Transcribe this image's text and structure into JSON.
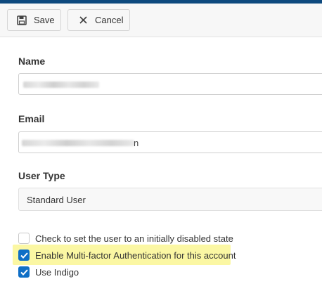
{
  "toolbar": {
    "save_label": "Save",
    "cancel_label": "Cancel"
  },
  "form": {
    "name_label": "Name",
    "email_label": "Email",
    "email_visible_tail": "n",
    "user_type_label": "User Type",
    "user_type_value": "Standard User"
  },
  "options": [
    {
      "label": "Check to set the user to an initially disabled state",
      "checked": false
    },
    {
      "label": "Enable Multi-factor Authentication for this account",
      "checked": true
    },
    {
      "label": "Use Indigo",
      "checked": true
    }
  ],
  "colors": {
    "accent": "#0f6fc6",
    "top_bar": "#0e4a7e",
    "highlight": "#fbf7a3"
  }
}
